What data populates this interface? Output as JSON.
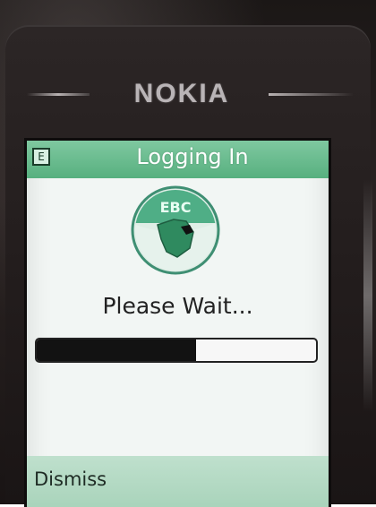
{
  "device": {
    "brand": "NOKIA"
  },
  "screen": {
    "title_bar": {
      "icon": "app-e-icon",
      "icon_glyph": "E",
      "title": "Logging In"
    },
    "logo": {
      "name": "ebc-logo-icon",
      "text": "EBC"
    },
    "status_text": "Please Wait...",
    "progress": {
      "fraction": 0.57
    },
    "softkeys": {
      "left": "Dismiss"
    }
  },
  "colors": {
    "title_bar": "#57b07f",
    "softkey_bar": "#a8d3ba",
    "progress_fill": "#121212",
    "screen_bg": "#f2f6f4"
  }
}
